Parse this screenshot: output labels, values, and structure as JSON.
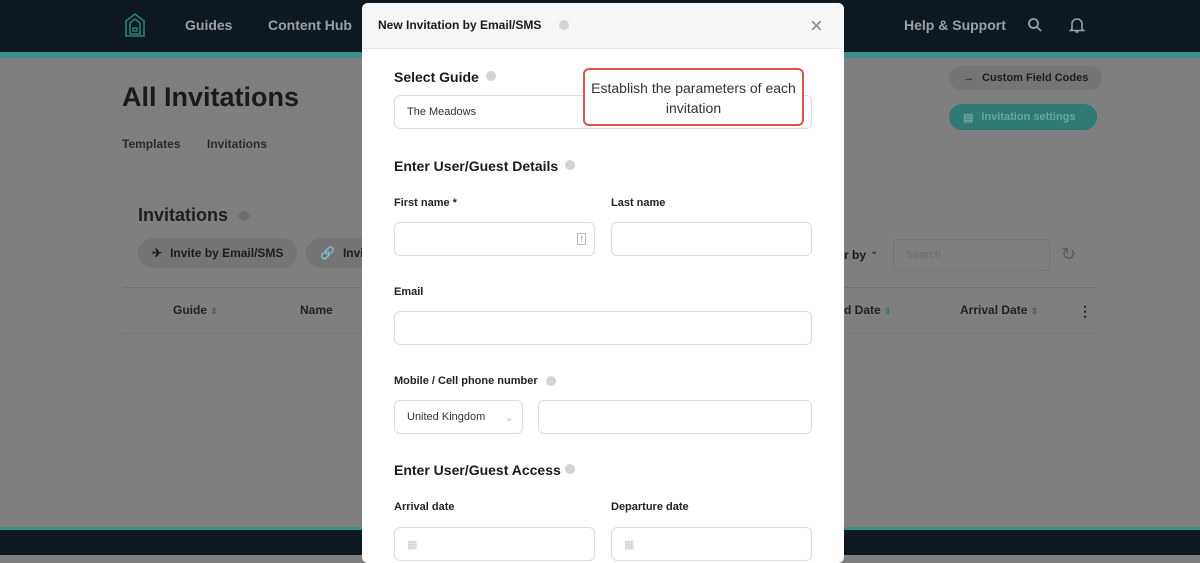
{
  "nav": {
    "logo": "house-logo",
    "items": [
      "Guides",
      "Content Hub"
    ],
    "help": "Help & Support"
  },
  "page": {
    "title": "All Invitations",
    "tabs": [
      "Templates",
      "Invitations"
    ],
    "custom_field_codes": "Custom Field Codes",
    "invitation_settings": "Invitation settings"
  },
  "invitations": {
    "title": "Invitations",
    "invite_email": "Invite by Email/SMS",
    "invite_link_partial": "Invit",
    "filter_partial": "r by",
    "search_placeholder": "Search",
    "columns": {
      "guide": "Guide",
      "name": "Name",
      "date_partial": "d Date",
      "arrival": "Arrival Date"
    }
  },
  "modal": {
    "title": "New Invitation by Email/SMS",
    "select_guide": "Select Guide",
    "guide_value": "The Meadows",
    "callout": "Establish the parameters of each invitation",
    "details_title": "Enter User/Guest Details",
    "first_name": "First name *",
    "last_name": "Last name",
    "email": "Email",
    "mobile": "Mobile / Cell phone number",
    "country": "United Kingdom",
    "access_title": "Enter User/Guest Access",
    "arrival": "Arrival date",
    "departure": "Departure date"
  },
  "colors": {
    "accent": "#3a8f86",
    "callout_border": "#d9534f",
    "nav": "#0e1820"
  }
}
